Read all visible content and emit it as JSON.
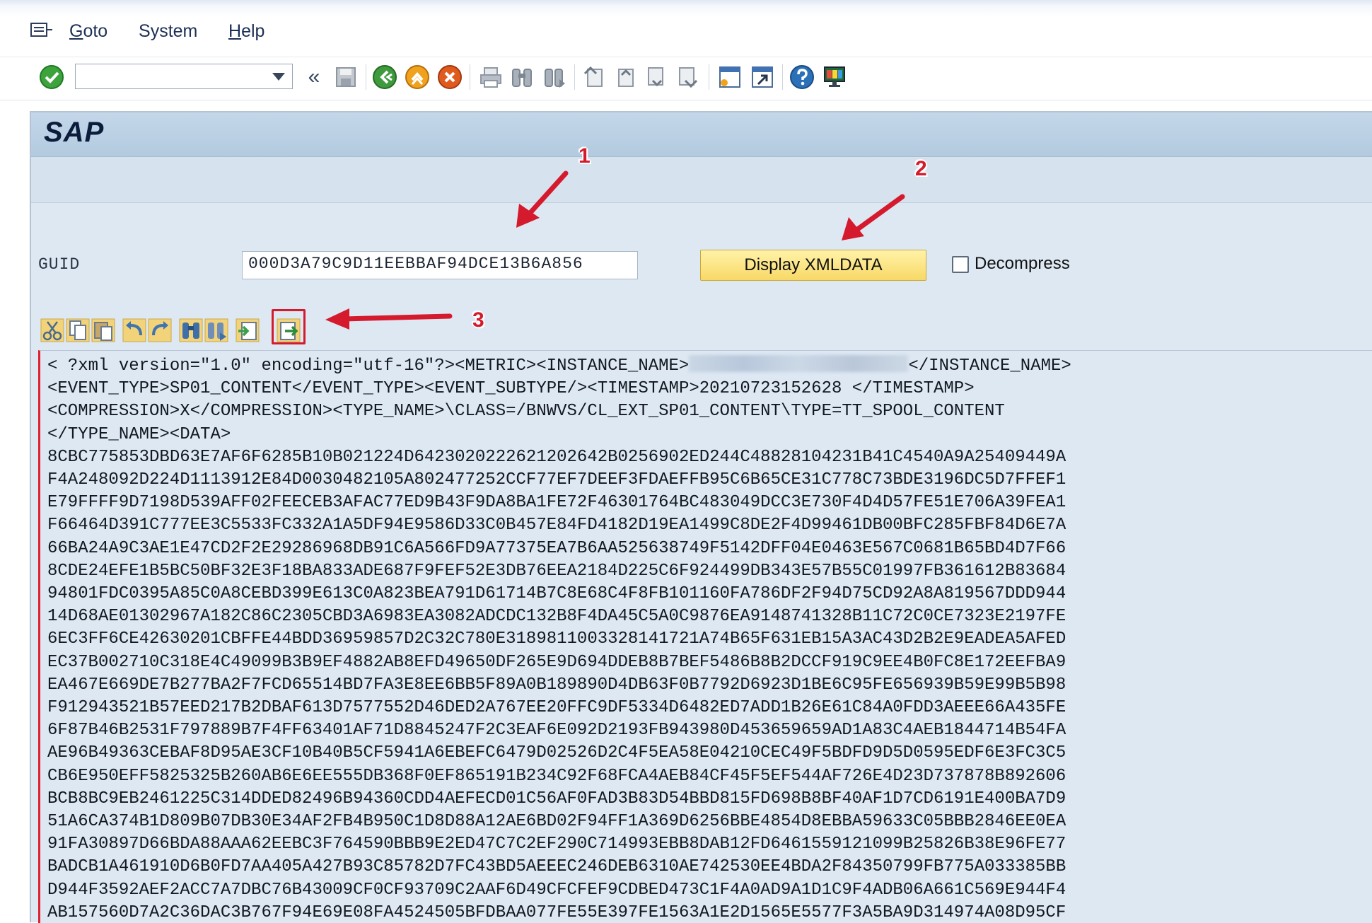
{
  "menu": {
    "items": [
      {
        "label": "Goto",
        "accel": "G",
        "rest": "oto"
      },
      {
        "label": "System",
        "accel": "S",
        "rest": "ystem"
      },
      {
        "label": "Help",
        "accel": "H",
        "rest": "elp"
      }
    ]
  },
  "toolbar": {
    "command_value": "",
    "back_symbol": "«"
  },
  "screen": {
    "title": "SAP",
    "guid_label": "GUID",
    "guid_value": "000D3A79C9D11EEBBAF94DCE13B6A856",
    "display_button": "Display XMLDATA",
    "decompress_label": "Decompress",
    "decompress_checked": false
  },
  "annotations": {
    "n1": "1",
    "n2": "2",
    "n3": "3",
    "color": "#d41a2c"
  },
  "editor": {
    "line1_prefix": "< ?xml version=\"1.0\" encoding=\"utf-16\"?><METRIC><INSTANCE_NAME>",
    "line1_suffix": "</INSTANCE_NAME>",
    "lines": [
      "<EVENT_TYPE>SP01_CONTENT</EVENT_TYPE><EVENT_SUBTYPE/><TIMESTAMP>20210723152628 </TIMESTAMP>",
      "<COMPRESSION>X</COMPRESSION><TYPE_NAME>\\CLASS=/BNWVS/CL_EXT_SP01_CONTENT\\TYPE=TT_SPOOL_CONTENT",
      "</TYPE_NAME><DATA>",
      "8CBC775853DBD63E7AF6F6285B10B021224D642302022262120264 2B0256902ED244C48828104231B41C4540A9A25409449A",
      "F4A248092D224D1113912E84D0030482105A802477252CCF77EF7DEEF3FDAEFFB95C6B65CE31C778C73BDE3196DC5D7FFEF1",
      "E79FFFF9D7198D539AFF02FEECEB3AFAC77ED9B43F9DA8BA1FE72F46301764BC483049DCC3E730F4D4D57FE51E706A39FEA1",
      "F66464D391C777EE3C5533FC332A1A5DF94E9586D33C0B457E84FD4182D19EA1499C8DE2F4D99461DB00BFC285FBF84D6E7A",
      "66BA24A9C3AE1E47CD2F2E29286968DB91C6A566FD9A77375EA7B6AA525638749F5142DFF04E0463E567C0681B65BD4D7F66",
      "8CDE24EFE1B5BC50BF32E3F18BA833ADE687F9FEF52E3DB76EEA2184D225C6F924499DB343E57B55C01997FB361612B83684",
      "94801FDC0395A85C0A8CEBD399E613C0A823BEA791D61714B7C8E68C4F8FB101160FA786DF2F94D75CD92A8A819567DDD944",
      "14D68AE01302967A182C86C2305CBD3A6983EA3082ADCDC132B8F4DA45C5A0C9876EA9148741328B11C72C0CE7323E2197FE",
      "6EC3FF6CE42630201CBFFE44BDD36959857D2C32C780E31898110033281417 21A74B65F631EB15A3AC43D2B2E9EADEA5AFED",
      "EC37B002710C318E4C49099B3B9EF4882AB8EFD49650DF265E9D694DDEB8B7BEF5486B8B2DCCF919C9EE4B0FC8E172EEFBA9",
      "EA467E669DE7B277BA2F7FCD65514BD7FA3E8EE6BB5F89A0B189890D4DB63F0B7792D6923D1BE6C95FE656939B59E99B5B98",
      "F912943521B57EED217B2DBAF613D7577552D46DED2A767EE20FFC9DF5334D6482ED7ADD1B26E61C84A0FDD3AEEE66A435FE",
      "6F87B46B2531F797889B7F4FF63401AF71D8845247F2C3EAF6E092D2193FB943980D453659659AD1A83C4AEB1844714B54FA",
      "AE96B49363CEBAF8D95AE3CF10B40B5CF5941A6EBEFC6479D02526D2C4F5EA58E04210CEC49F5BDFD9D5D0595EDF6E3FC3C5",
      "CB6E950EFF5825325B260AB6E6EE555DB368F0EF865191B234C92F68FCA4AEB84CF45F5EF544AF726E4D23D737878B892606",
      "BCB8BC9EB2461225C314DDED82496B94360CDD4AEFECD01C56AF0FAD3B83D54BBD815FD698B8BF40AF1D7CD6191E400BA7D9",
      "51A6CA374B1D809B07DB30E34AF2FB4B950C1D8D88A12AE6BD02F94FF1A369D6256BBE4854D8EBBA59633C05BBB2846EE0EA",
      "91FA30897D66BDA88AAA62EEBC3F764590BBB9E2ED47C7C2EF290C714993EBB8DAB12FD6461559121099B25826B38E96FE77",
      "BADCB1A461910D6B0FD7AA405A427B93C85782D7FC43BD5AEEEC246DEB6310AE742530EE4BDA2F84350799FB775A033385BB",
      "D944F3592AEF2ACC7A7DBC76B43009CF0CF93709C2AAF6D49CFCFEF9CDBED473C1F4A0AD9A1D1C9F4ADB06A661C569E944F4",
      "AB157560D7A2C36DAC3B767F94E69E08FA4524505BFDBAA077FE55E397FE1563A1E2D1565E5577F3A5BA9D314974A08D95CF"
    ]
  }
}
